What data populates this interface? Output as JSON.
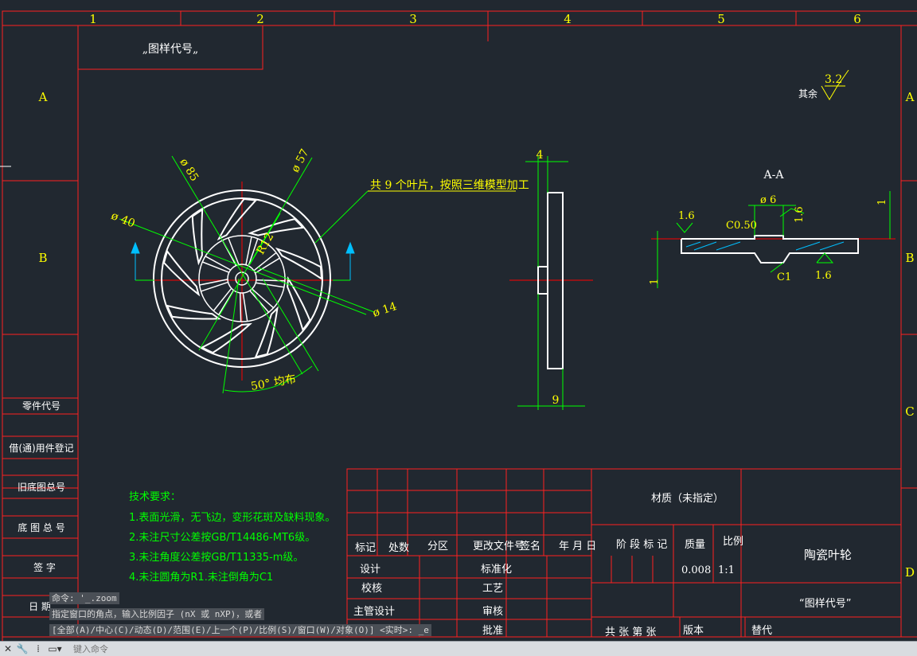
{
  "zones": {
    "columns": [
      "1",
      "2",
      "3",
      "4",
      "5",
      "6"
    ],
    "rows": [
      "A",
      "B",
      "C",
      "D"
    ]
  },
  "drawing": {
    "stamp_top_left": "„图样代号„",
    "roughness_label": "其余",
    "roughness_value": "3.2",
    "dims": {
      "d85": "ø 85",
      "d57": "ø 57",
      "d40": "ø 40",
      "d14": "ø 14",
      "r12": "R12",
      "angle": "50° 均布",
      "blade_note": "共 9 个叶片，按照三维模型加工",
      "side_top": "4",
      "side_bottom": "9",
      "section_title": "A-A",
      "s_d6": "ø 6",
      "s_rough1": "1.6",
      "s_rough2": "1.6",
      "s_chamfer": "C0.50",
      "s_c1": "C1",
      "s_16": "1.6",
      "s_1a": "1",
      "s_1b": "1"
    },
    "tech": {
      "title": "技术要求：",
      "items": [
        "1.表面光滑，无飞边，变形花斑及缺料现象。",
        "2.未注尺寸公差按GB/T14486-MT6级。",
        "3.未注角度公差按GB/T11335-m级。",
        "4.未注圆角为R1.未注倒角为C1"
      ]
    },
    "left_panel": [
      "零件代号",
      "借(通)用件登记",
      "旧底图总号",
      "底 图 总 号",
      "签   字",
      "日   期"
    ],
    "title_block": {
      "material": "材质（未指定）",
      "hdr_biaoji": "标记",
      "hdr_chushu": "处数",
      "hdr_fenqu": "分区",
      "hdr_gengai": "更改文件号",
      "hdr_qianming": "签名",
      "hdr_date": "年 月 日",
      "sheji": "设计",
      "biaozhunhua": "标准化",
      "jiaohe": "校核",
      "gongyi": "工艺",
      "zhuguan": "主管设计",
      "shenhe": "审核",
      "pizhun": "批准",
      "jieduan": "阶 段 标 记",
      "zhiliang": "质量",
      "bili": "比例",
      "mass": "0.008",
      "scale": "1:1",
      "part_name": "陶瓷叶轮",
      "drawing_no": "“图样代号”",
      "sheets": "共  张   第  张",
      "banben": "版本",
      "tidai": "替代"
    }
  },
  "command": {
    "history": [
      "命令: '_.zoom",
      "指定窗口的角点，输入比例因子 (nX 或 nXP)，或者",
      "[全部(A)/中心(C)/动态(D)/范围(E)/上一个(P)/比例(S)/窗口(W)/对象(O)] <实时>: _e"
    ],
    "placeholder": "键入命令"
  },
  "colors": {
    "background": "#212830",
    "frame": "#ff2020",
    "geometry": "#ffffff",
    "dimension": "#00ff00",
    "text": "#ffff00",
    "center": "#ff0000",
    "arrow": "#00bfff"
  }
}
